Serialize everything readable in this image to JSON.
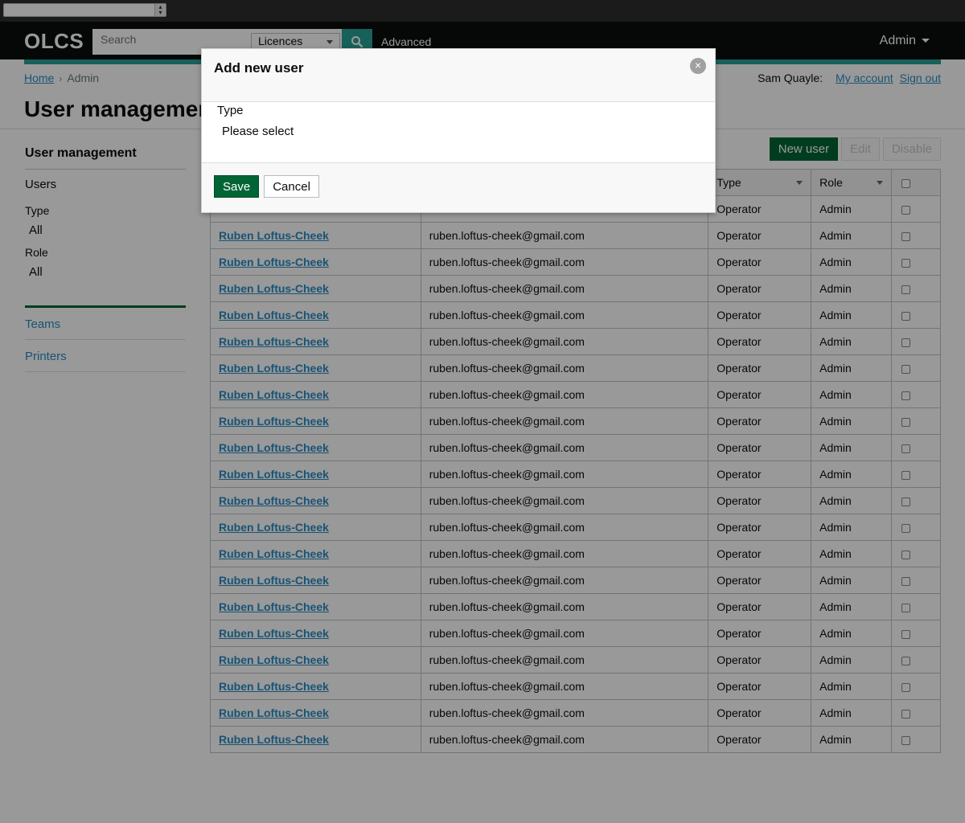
{
  "header": {
    "logo": "OLCS",
    "search_placeholder": "Search",
    "search_scope": "Licences",
    "advanced_label": "Advanced",
    "admin_menu": "Admin"
  },
  "breadcrumb": {
    "home": "Home",
    "current": "Admin"
  },
  "user_links": {
    "name": "Sam Quayle:",
    "my_account": "My account",
    "sign_out": "Sign out"
  },
  "page_title": "User management",
  "sidebar": {
    "heading": "User management",
    "users_label": "Users",
    "type_label": "Type",
    "type_value": "All",
    "role_label": "Role",
    "role_value": "All",
    "links": [
      "Teams",
      "Printers"
    ]
  },
  "actions": {
    "new_user": "New user",
    "edit": "Edit",
    "disable": "Disable"
  },
  "table": {
    "columns": {
      "type": "Type",
      "role": "Role"
    },
    "rows": [
      {
        "name": "Ruben Loftus-Cheek",
        "email": "ruben.loftus-cheek@gmail.com",
        "type": "Operator",
        "role": "Admin"
      },
      {
        "name": "Ruben Loftus-Cheek",
        "email": "ruben.loftus-cheek@gmail.com",
        "type": "Operator",
        "role": "Admin"
      },
      {
        "name": "Ruben Loftus-Cheek",
        "email": "ruben.loftus-cheek@gmail.com",
        "type": "Operator",
        "role": "Admin"
      },
      {
        "name": "Ruben Loftus-Cheek",
        "email": "ruben.loftus-cheek@gmail.com",
        "type": "Operator",
        "role": "Admin"
      },
      {
        "name": "Ruben Loftus-Cheek",
        "email": "ruben.loftus-cheek@gmail.com",
        "type": "Operator",
        "role": "Admin"
      },
      {
        "name": "Ruben Loftus-Cheek",
        "email": "ruben.loftus-cheek@gmail.com",
        "type": "Operator",
        "role": "Admin"
      },
      {
        "name": "Ruben Loftus-Cheek",
        "email": "ruben.loftus-cheek@gmail.com",
        "type": "Operator",
        "role": "Admin"
      },
      {
        "name": "Ruben Loftus-Cheek",
        "email": "ruben.loftus-cheek@gmail.com",
        "type": "Operator",
        "role": "Admin"
      },
      {
        "name": "Ruben Loftus-Cheek",
        "email": "ruben.loftus-cheek@gmail.com",
        "type": "Operator",
        "role": "Admin"
      },
      {
        "name": "Ruben Loftus-Cheek",
        "email": "ruben.loftus-cheek@gmail.com",
        "type": "Operator",
        "role": "Admin"
      },
      {
        "name": "Ruben Loftus-Cheek",
        "email": "ruben.loftus-cheek@gmail.com",
        "type": "Operator",
        "role": "Admin"
      },
      {
        "name": "Ruben Loftus-Cheek",
        "email": "ruben.loftus-cheek@gmail.com",
        "type": "Operator",
        "role": "Admin"
      },
      {
        "name": "Ruben Loftus-Cheek",
        "email": "ruben.loftus-cheek@gmail.com",
        "type": "Operator",
        "role": "Admin"
      },
      {
        "name": "Ruben Loftus-Cheek",
        "email": "ruben.loftus-cheek@gmail.com",
        "type": "Operator",
        "role": "Admin"
      },
      {
        "name": "Ruben Loftus-Cheek",
        "email": "ruben.loftus-cheek@gmail.com",
        "type": "Operator",
        "role": "Admin"
      },
      {
        "name": "Ruben Loftus-Cheek",
        "email": "ruben.loftus-cheek@gmail.com",
        "type": "Operator",
        "role": "Admin"
      },
      {
        "name": "Ruben Loftus-Cheek",
        "email": "ruben.loftus-cheek@gmail.com",
        "type": "Operator",
        "role": "Admin"
      },
      {
        "name": "Ruben Loftus-Cheek",
        "email": "ruben.loftus-cheek@gmail.com",
        "type": "Operator",
        "role": "Admin"
      },
      {
        "name": "Ruben Loftus-Cheek",
        "email": "ruben.loftus-cheek@gmail.com",
        "type": "Operator",
        "role": "Admin"
      },
      {
        "name": "Ruben Loftus-Cheek",
        "email": "ruben.loftus-cheek@gmail.com",
        "type": "Operator",
        "role": "Admin"
      }
    ],
    "first_row": {
      "type": "Operator",
      "role": "Admin"
    }
  },
  "modal": {
    "title": "Add new user",
    "close_icon": "close-icon",
    "type_label": "Type",
    "type_value": "Please select",
    "save": "Save",
    "cancel": "Cancel"
  },
  "colors": {
    "brand_green": "#006435",
    "accent_teal": "#28a197",
    "link": "#2b8cc4"
  }
}
